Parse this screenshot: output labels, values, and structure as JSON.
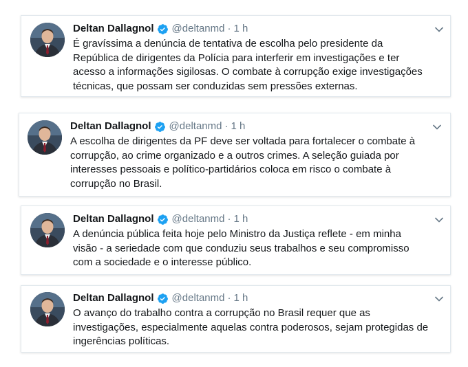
{
  "tweets": [
    {
      "name": "Deltan Dallagnol",
      "handle": "@deltanmd",
      "separator": "·",
      "time": "1 h",
      "text": "É gravíssima a denúncia de tentativa de escolha pelo presidente da\nRepública de dirigentes da Polícia para interferir em investigações e ter\nacesso a informações sigilosas. O combate à corrupção exige investigações\ntécnicas, que possam ser conduzidas sem pressões externas."
    },
    {
      "name": "Deltan Dallagnol",
      "handle": "@deltanmd",
      "separator": "·",
      "time": "1 h",
      "text": "A escolha de dirigentes da PF deve ser voltada para fortalecer o combate à\ncorrupção, ao crime organizado e a outros crimes. A seleção guiada por\ninteresses pessoais e político-partidários coloca em risco o combate à\ncorrupção no Brasil."
    },
    {
      "name": "Deltan Dallagnol",
      "handle": "@deltanmd",
      "separator": "·",
      "time": "1 h",
      "text": "A denúncia pública feita hoje pelo Ministro da Justiça reflete - em minha\nvisão - a seriedade com que conduziu seus trabalhos e seu compromisso\ncom a sociedade e o interesse público."
    },
    {
      "name": "Deltan Dallagnol",
      "handle": "@deltanmd",
      "separator": "·",
      "time": "1 h",
      "text": "O avanço do trabalho contra a corrupção no Brasil requer que as\ninvestigações, especialmente aquelas contra poderosos, sejam protegidas de\ningerências políticas."
    }
  ],
  "icons": {
    "avatar": "profile-photo",
    "verified": "verified-badge-icon",
    "caret": "chevron-down-icon"
  },
  "colors": {
    "verified": "#1da1f2",
    "secondary_text": "#657786",
    "border": "#e1e8ed"
  }
}
